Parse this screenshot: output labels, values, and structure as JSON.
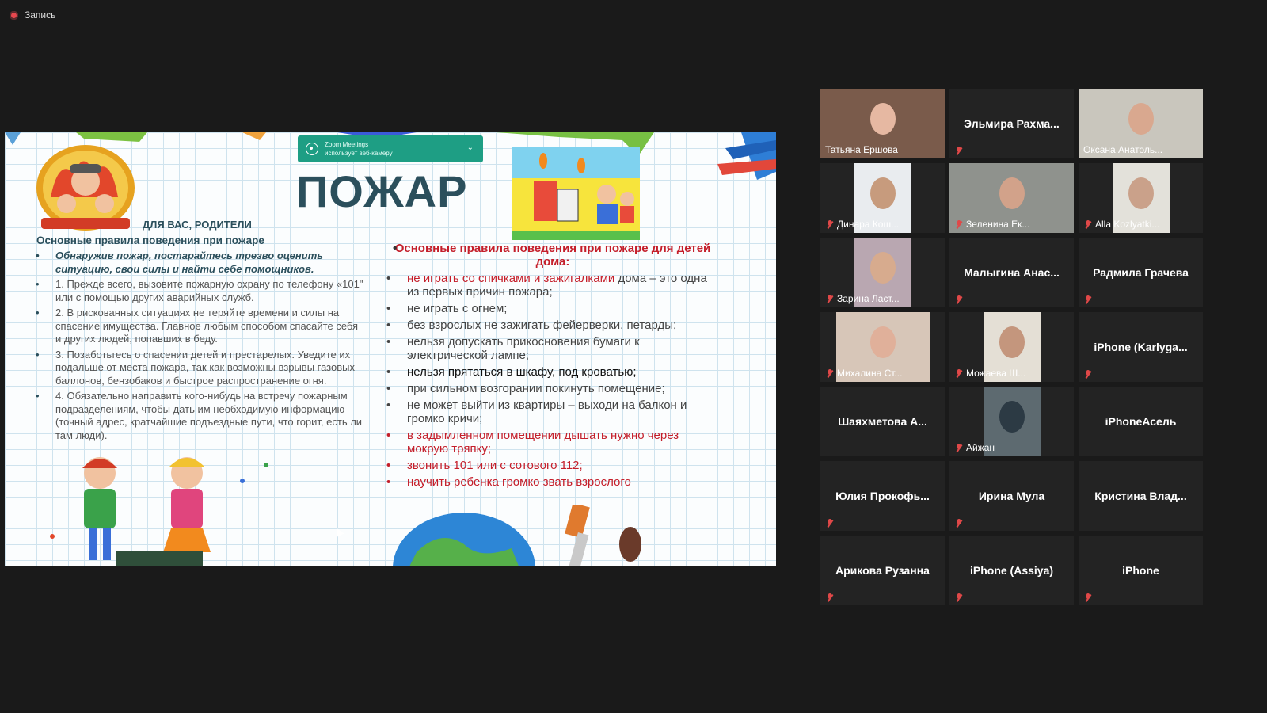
{
  "recording": {
    "label": "Запись",
    "icon": "record-dot-icon"
  },
  "slide": {
    "popup": {
      "line1": "Zoom Meetings",
      "line2": "использует веб-камеру"
    },
    "title": "ПОЖАР",
    "parents_label": "ДЛЯ ВАС, РОДИТЕЛИ",
    "left_heading": "Основные правила поведения при пожаре",
    "left_items": [
      "Обнаружив пожар, постарайтесь трезво оценить ситуацию, свои силы и найти себе помощников.",
      "1. Прежде всего, вызовите пожарную охрану по телефону «101\" или с помощью других аварийных служб.",
      "2. В рискованных ситуациях не теряйте времени и силы на спасение имущества. Главное любым способом спасайте себя и других людей, попавших в беду.",
      "3. Позаботьтесь о спасении детей и престарелых. Уведите их подальше от места пожара, так как возможны взрывы газовых баллонов, бензобаков и быстрое распространение огня.",
      "4. Обязательно направить кого-нибудь на встречу пожарным подразделениям, чтобы дать им необходимую информацию (точный адрес, кратчайшие подъездные пути, что горит, есть ли там люди)."
    ],
    "right_heading": "Основные правила поведения при пожаре для детей дома:",
    "right_items": {
      "i1_red": "не играть со спичками и зажигалками",
      "i1_rest": " дома – это одна из первых причин пожара;",
      "i2": "не играть с огнем;",
      "i3": "без взрослых не зажигать фейерверки, петарды;",
      "i4": "нельзя допускать прикосновения бумаги к электрической лампе;",
      "i5": "нельзя прятаться в шкафу, под кроватью;",
      "i6": "при сильном возгорании покинуть помещение;",
      "i7": "не может выйти из квартиры – выходи на балкон и громко кричи;",
      "i8": "в задымленном помещении дышать нужно через мокрую тряпку;",
      "i9": "звонить 101 или с сотового 112;",
      "i10": "научить ребенка громко звать взрослого"
    }
  },
  "participants": [
    {
      "name": "Татьяна Ершова",
      "video": true,
      "active": true,
      "muted": false,
      "bg": "#7a5b4b",
      "face": "#e6b8a2"
    },
    {
      "name": "Эльмира  Рахма...",
      "video": false,
      "muted": true
    },
    {
      "name": "Оксана Анатоль...",
      "video": true,
      "muted": false,
      "bg": "#c9c6bd",
      "face": "#d9a88f"
    },
    {
      "name": "Динара Кош...",
      "video": true,
      "muted": true,
      "bg": "#e9ecef",
      "face": "#c79b7d"
    },
    {
      "name": "Зеленина Ек...",
      "video": true,
      "muted": true,
      "bg": "#8f928d",
      "face": "#d2a28a"
    },
    {
      "name": "Alla Kozlyatki...",
      "video": true,
      "muted": true,
      "bg": "#e3e1da",
      "face": "#caa18a"
    },
    {
      "name": "Зарина Ласт...",
      "video": true,
      "muted": true,
      "bg": "#b9a7b1",
      "face": "#d7ab8e"
    },
    {
      "name": "Малыгина  Анас...",
      "video": false,
      "muted": true
    },
    {
      "name": "Радмила Грачева",
      "video": false,
      "muted": true
    },
    {
      "name": "Михалина Ст...",
      "video": true,
      "muted": true,
      "bg": "#d7c6b8",
      "face": "#e0b09a"
    },
    {
      "name": "Можаева Ш...",
      "video": true,
      "muted": true,
      "bg": "#e4dfd5",
      "face": "#c4967d"
    },
    {
      "name": "iPhone  (Karlyga...",
      "video": false,
      "muted": true
    },
    {
      "name": "Шаяхметова  А...",
      "video": false,
      "muted": false
    },
    {
      "name": "Айжан",
      "video": true,
      "muted": true,
      "bg": "#5d6a70",
      "face": "#2c3a44"
    },
    {
      "name": "iPhoneАсель",
      "video": false,
      "muted": false
    },
    {
      "name": "Юлия  Прокофь...",
      "video": false,
      "muted": true
    },
    {
      "name": "Ирина Мула",
      "video": false,
      "muted": true
    },
    {
      "name": "Кристина  Влад...",
      "video": false,
      "muted": false
    },
    {
      "name": "Арикова Рузанна",
      "video": false,
      "muted": true
    },
    {
      "name": "iPhone (Assiya)",
      "video": false,
      "muted": true
    },
    {
      "name": "iPhone",
      "video": false,
      "muted": true
    }
  ]
}
